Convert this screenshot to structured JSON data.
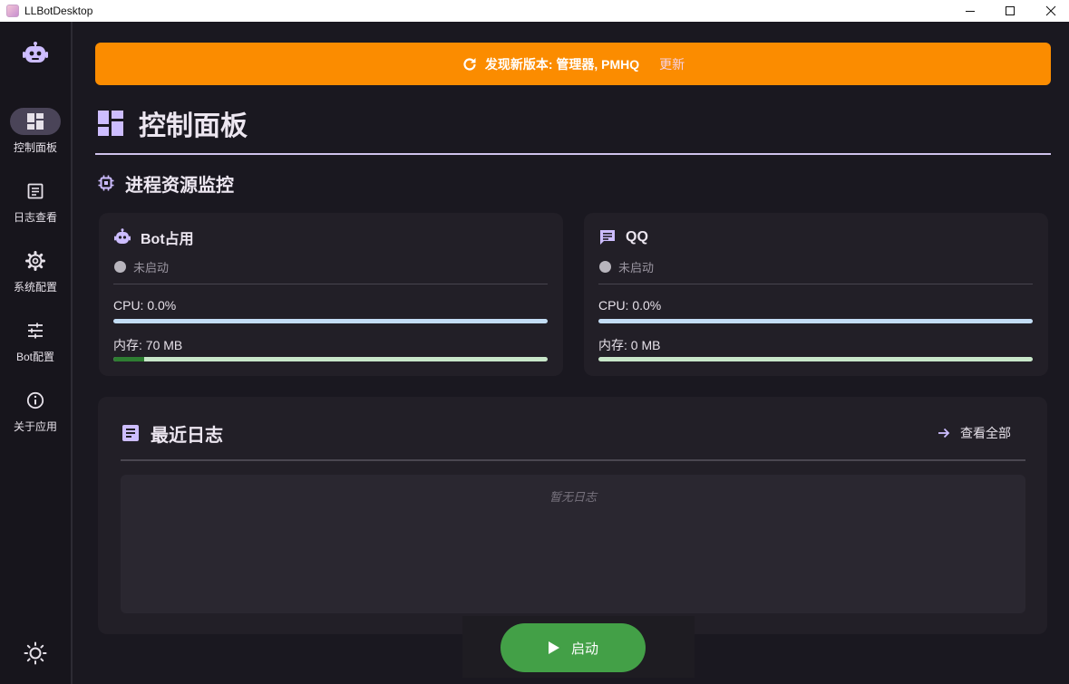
{
  "window": {
    "title": "LLBotDesktop"
  },
  "sidebar": {
    "items": [
      {
        "label": "控制面板",
        "icon": "dashboard-icon",
        "active": true
      },
      {
        "label": "日志查看",
        "icon": "log-icon",
        "active": false
      },
      {
        "label": "系统配置",
        "icon": "gear-icon",
        "active": false
      },
      {
        "label": "Bot配置",
        "icon": "tune-icon",
        "active": false
      },
      {
        "label": "关于应用",
        "icon": "info-icon",
        "active": false
      }
    ]
  },
  "banner": {
    "message": "发现新版本: 管理器, PMHQ",
    "link": "更新"
  },
  "page": {
    "title": "控制面板"
  },
  "monitor": {
    "title": "进程资源监控",
    "cards": [
      {
        "title": "Bot占用",
        "status": "未启动",
        "cpu": "CPU: 0.0%",
        "cpu_fraction": 0.0,
        "mem": "内存: 70 MB",
        "mem_fraction": 0.07
      },
      {
        "title": "QQ",
        "status": "未启动",
        "cpu": "CPU: 0.0%",
        "cpu_fraction": 0.0,
        "mem": "内存: 0 MB",
        "mem_fraction": 0.0
      }
    ]
  },
  "logs": {
    "title": "最近日志",
    "view_all": "查看全部",
    "empty": "暂无日志"
  },
  "actions": {
    "start_label": "启动"
  },
  "colors": {
    "accent": "#cdbdff",
    "banner": "#fb8c00",
    "start": "#43a047"
  }
}
